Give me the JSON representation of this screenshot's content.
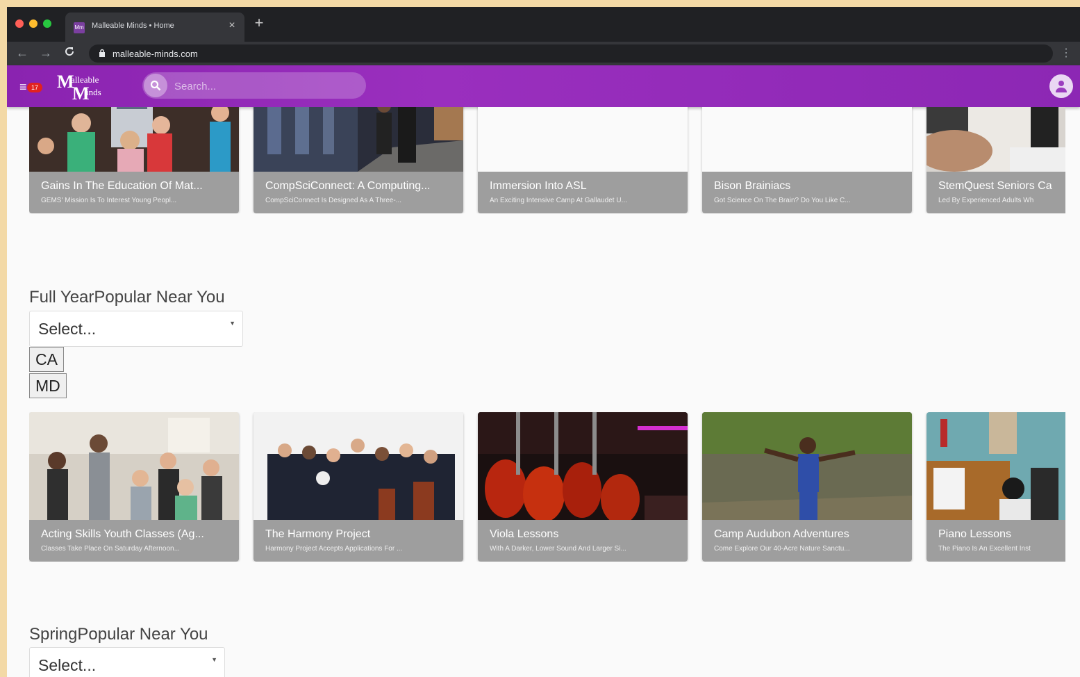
{
  "browser": {
    "tab_title": "Malleable Minds • Home",
    "favicon": "Mm",
    "url": "malleable-minds.com",
    "close_icon": "×",
    "new_tab_icon": "+",
    "back_icon": "←",
    "forward_icon": "→",
    "reload_icon": "C",
    "lock_icon": "🔒",
    "menu_icon": "⋮"
  },
  "header": {
    "menu_icon": "≡",
    "notification_count": "17",
    "logo": {
      "m1": "M",
      "line1": "alleable",
      "m2": "M",
      "line2": "inds"
    },
    "search_placeholder": "Search...",
    "accent_color": "#8e24aa"
  },
  "rows": [
    {
      "cards": [
        {
          "title": "Gains In The Education Of Mat...",
          "subtitle": "GEMS' Mission Is To Interest Young Peopl...",
          "image": "kids-science"
        },
        {
          "title": "CompSciConnect: A Computing...",
          "subtitle": "CompSciConnect Is Designed As A Three-...",
          "image": "computing-hallway"
        },
        {
          "title": "Immersion Into ASL",
          "subtitle": "An Exciting Intensive Camp At Gallaudet U...",
          "image": "blank"
        },
        {
          "title": "Bison Brainiacs",
          "subtitle": "Got Science On The Brain? Do You Like C...",
          "image": "blank"
        },
        {
          "title": "StemQuest Seniors Ca",
          "subtitle": "Led By Experienced Adults Wh",
          "image": "microscope"
        }
      ]
    },
    {
      "cards": [
        {
          "title": "Acting Skills Youth Classes (Ag...",
          "subtitle": "Classes Take Place On Saturday Afternoon...",
          "image": "acting-kids"
        },
        {
          "title": "The Harmony Project",
          "subtitle": "Harmony Project Accepts Applications For ...",
          "image": "orchestra"
        },
        {
          "title": "Viola Lessons",
          "subtitle": "With A Darker, Lower Sound And Larger Si...",
          "image": "violas"
        },
        {
          "title": "Camp Audubon Adventures",
          "subtitle": "Come Explore Our 40-Acre Nature Sanctu...",
          "image": "creek-kid"
        },
        {
          "title": "Piano Lessons",
          "subtitle": "The Piano Is An Excellent Inst",
          "image": "piano"
        }
      ]
    }
  ],
  "sections": [
    {
      "title": "Full YearPopular Near You",
      "select_text": "Select...",
      "states": [
        "CA",
        "MD"
      ]
    },
    {
      "title": "SpringPopular Near You",
      "select_text": "Select..."
    }
  ]
}
